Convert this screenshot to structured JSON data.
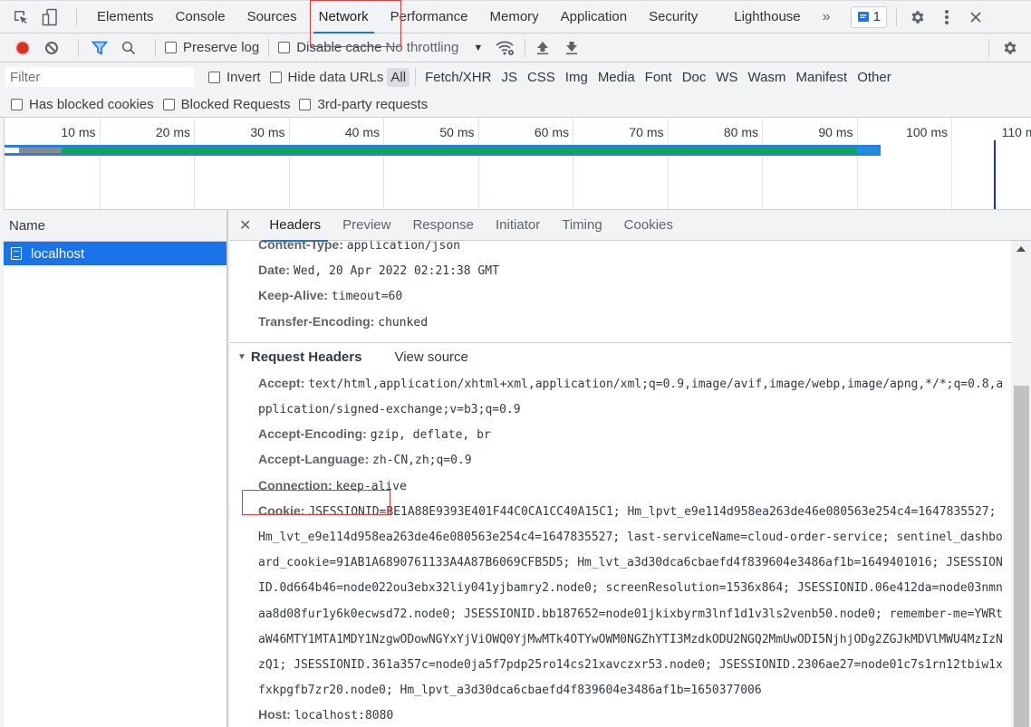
{
  "top_tabs": [
    "Elements",
    "Console",
    "Sources",
    "Network",
    "Performance",
    "Memory",
    "Application",
    "Security",
    "Lighthouse"
  ],
  "active_top_tab": "Network",
  "more_tabs_label": "»",
  "messages_count": "1",
  "toolbar": {
    "preserve_log": "Preserve log",
    "disable_cache": "Disable cache",
    "throttling": "No throttling",
    "throttling_arrow": "▼"
  },
  "filter": {
    "placeholder": "Filter",
    "value": "",
    "invert": "Invert",
    "hide_data_urls": "Hide data URLs",
    "types": [
      "All",
      "Fetch/XHR",
      "JS",
      "CSS",
      "Img",
      "Media",
      "Font",
      "Doc",
      "WS",
      "Wasm",
      "Manifest",
      "Other"
    ],
    "active_type": "All",
    "has_blocked_cookies": "Has blocked cookies",
    "blocked_requests": "Blocked Requests",
    "third_party": "3rd-party requests"
  },
  "timeline": {
    "ticks": [
      "10 ms",
      "20 ms",
      "30 ms",
      "40 ms",
      "50 ms",
      "60 ms",
      "70 ms",
      "80 ms",
      "90 ms",
      "100 ms",
      "110 ms"
    ],
    "request_start_ms": 0,
    "waiting_start_ms": 1.5,
    "download_start_ms": 6,
    "download_end_ms": 90,
    "request_end_ms": 92.5,
    "load_event_ms": 104.5,
    "colors": {
      "bar": "#2a7de1",
      "waiting": "#8a8a8a",
      "download": "#0ca84e",
      "tail": "#1e90e0",
      "load": "#1f2cc7"
    }
  },
  "name_pane": {
    "header": "Name",
    "requests": [
      "localhost"
    ]
  },
  "detail_tabs": [
    "Headers",
    "Preview",
    "Response",
    "Initiator",
    "Timing",
    "Cookies"
  ],
  "active_detail_tab": "Headers",
  "response_headers": [
    {
      "name": "Content-Type",
      "value": "application/json"
    },
    {
      "name": "Date",
      "value": "Wed, 20 Apr 2022 02:21:38 GMT"
    },
    {
      "name": "Keep-Alive",
      "value": "timeout=60"
    },
    {
      "name": "Transfer-Encoding",
      "value": "chunked"
    }
  ],
  "request_section": {
    "title": "Request Headers",
    "view_source": "View source"
  },
  "request_headers": [
    {
      "name": "Accept",
      "value": "text/html,application/xhtml+xml,application/xml;q=0.9,image/avif,image/webp,image/apng,*/*;q=0.8,application/signed-exchange;v=b3;q=0.9"
    },
    {
      "name": "Accept-Encoding",
      "value": "gzip, deflate, br"
    },
    {
      "name": "Accept-Language",
      "value": "zh-CN,zh;q=0.9"
    },
    {
      "name": "Connection",
      "value": "keep-alive"
    },
    {
      "name": "Cookie",
      "value": "JSESSIONID=BE1A88E9393E401F44C0CA1CC40A15C1; Hm_lpvt_e9e114d958ea263de46e080563e254c4=1647835527; Hm_lvt_e9e114d958ea263de46e080563e254c4=1647835527; last-serviceName=cloud-order-service; sentinel_dashboard_cookie=91AB1A6890761133A4A87B6069CFB5D5; Hm_lvt_a3d30dca6cbaefd4f839604e3486af1b=1649401016; JSESSIONID.0d664b46=node022ou3ebx32liy041yjbamry2.node0; screenResolution=1536x864; JSESSIONID.06e412da=node03nmnaa8d08fur1y6k0ecwsd72.node0; JSESSIONID.bb187652=node01jkixbyrm3lnf1d1v3ls2venb50.node0; remember-me=YWRtaW46MTY1MTA1MDY1NzgwODowNGYxYjViOWQ0YjMwMTk4OTYwOWM0NGZhYTI3MzdkODU2NGQ2MmUwODI5NjhjODg2ZGJkMDVlMWU4MzIzNzQ1; JSESSIONID.361a357c=node0ja5f7pdp25ro14cs21xavczxr53.node0; JSESSIONID.2306ae27=node01c7s1rn12tbiw1xfxkpgfb7zr20.node0; Hm_lpvt_a3d30dca6cbaefd4f839604e3486af1b=1650377006"
    },
    {
      "name": "Host",
      "value": "localhost:8080"
    }
  ]
}
